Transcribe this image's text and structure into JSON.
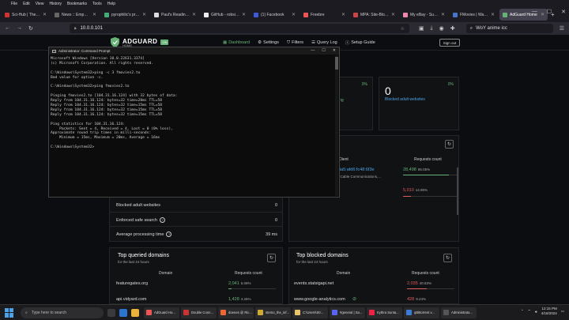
{
  "menu": [
    "File",
    "Edit",
    "View",
    "History",
    "Bookmarks",
    "Tools",
    "Help"
  ],
  "tabs": [
    {
      "label": "Sci-Hub | The Ethi",
      "color": "#c33"
    },
    {
      "label": "News :: Emperorium",
      "color": "#666"
    },
    {
      "label": "pyrophilic's profile",
      "color": "#4a7"
    },
    {
      "label": "Paul's Reading Pro",
      "color": "#ddd"
    },
    {
      "label": "GitHub - robsinc/t",
      "color": "#eee"
    },
    {
      "label": "(1) Facebook",
      "color": "#3b5bdb"
    },
    {
      "label": "Freebre",
      "color": "#e55"
    },
    {
      "label": "MPA: Site-Blocking",
      "color": "#c44"
    },
    {
      "label": "My eBay - Summary",
      "color": "#e8a"
    },
    {
      "label": "FMovies | Watch Fr",
      "color": "#47c"
    },
    {
      "label": "AdGuard Home",
      "color": "#67b279",
      "active": true
    }
  ],
  "url": "10.0.0.101",
  "search_text": "WoY anime icc",
  "adguard": {
    "name": "ADGUARD",
    "home": "HOME",
    "badge": "ON",
    "nav": [
      "Dashboard",
      "Settings",
      "Filters",
      "Query Log",
      "Setup Guide"
    ],
    "signout": "Sign out"
  },
  "stats_top": [
    {
      "pct": "0%",
      "value": "",
      "label": "ing"
    },
    {
      "pct": "0%",
      "value": "0",
      "label": "Blocked adult websites"
    }
  ],
  "top_clients": {
    "col_client": "Client",
    "col_requests": "Requests count",
    "rows": [
      {
        "client": "0a5:afd6:fc48:6f3e",
        "sub": "t Cable Communications,...",
        "count": "28,498",
        "pct": "85.05%",
        "fill": 0.85,
        "color": "#67b279"
      },
      {
        "client": "",
        "sub": "",
        "count": "5,010",
        "pct": "14.95%",
        "fill": 0.15,
        "color": "#e25c5c"
      }
    ]
  },
  "general_stats": [
    {
      "label": "Blocked adult websites",
      "value": "0",
      "help": false
    },
    {
      "label": "Enforced safe search",
      "value": "0",
      "help": true
    },
    {
      "label": "Average processing time",
      "value": "39 ms",
      "help": true
    }
  ],
  "top_queried": {
    "title": "Top queried domains",
    "sub": "for the last 24 hours",
    "col_domain": "Domain",
    "col_requests": "Requests count",
    "rows": [
      {
        "domain": "featuregates.org",
        "count": "2,041",
        "pct": "6.09%",
        "fill": 0.06
      },
      {
        "domain": "api.vidyard.com",
        "count": "1,428",
        "pct": "4.26%",
        "fill": 0.04
      }
    ]
  },
  "top_blocked": {
    "title": "Top blocked domains",
    "sub": "for the last 24 hours",
    "col_domain": "Domain",
    "col_requests": "Requests count",
    "rows": [
      {
        "domain": "events.statsigapi.net",
        "count": "2,035",
        "pct": "40.83%",
        "fill": 0.41
      },
      {
        "domain": "www.google-analytics.com",
        "count": "428",
        "pct": "9.24%",
        "fill": 0.09
      }
    ]
  },
  "cmd": {
    "title": "Administrator: Command Prompt",
    "lines": [
      "Microsoft Windows [Version 10.0.22631.3374]",
      "(c) Microsoft Corporation. All rights reserved.",
      "",
      "C:\\Windows\\System32>ping -c 3 fmovies2.to",
      "Bad value for option -c.",
      "",
      "C:\\Windows\\System32>ping fmovies2.to",
      "",
      "Pinging fmovies2.to [104.31.16.124] with 32 bytes of data:",
      "Reply from 104.31.16.124: bytes=32 time=20ms TTL=58",
      "Reply from 104.31.16.124: bytes=32 time=15ms TTL=58",
      "Reply from 104.31.16.124: bytes=32 time=15ms TTL=58",
      "Reply from 104.31.16.124: bytes=32 time=15ms TTL=58",
      "",
      "Ping statistics for 104.31.16.124:",
      "    Packets: Sent = 4, Received = 4, Lost = 0 (0% loss),",
      "Approximate round trip times in milli-seconds:",
      "    Minimum = 15ms, Maximum = 20ms, Average = 16ms",
      "",
      "C:\\Windows\\System32>"
    ]
  },
  "taskbar": {
    "search_placeholder": "Type here to search",
    "apps": [
      {
        "label": "AdGuard Ho...",
        "color": "#e55"
      },
      {
        "label": "Double Conn...",
        "color": "#c33"
      },
      {
        "label": "doenes @ Ric...",
        "color": "#e63"
      },
      {
        "label": "sterno_the_inf...",
        "color": "#ca3"
      },
      {
        "label": "C:\\Users\\S0...",
        "color": "#e9c46a"
      },
      {
        "label": "#general | Sa...",
        "color": "#5865f2"
      },
      {
        "label": "Kythra Sunta...",
        "color": "#e24"
      },
      {
        "label": "qBittorrent v...",
        "color": "#3a7bd5"
      },
      {
        "label": "Administrato...",
        "color": "#555"
      }
    ],
    "time": "12:15 PM",
    "date": "4/18/2024"
  }
}
